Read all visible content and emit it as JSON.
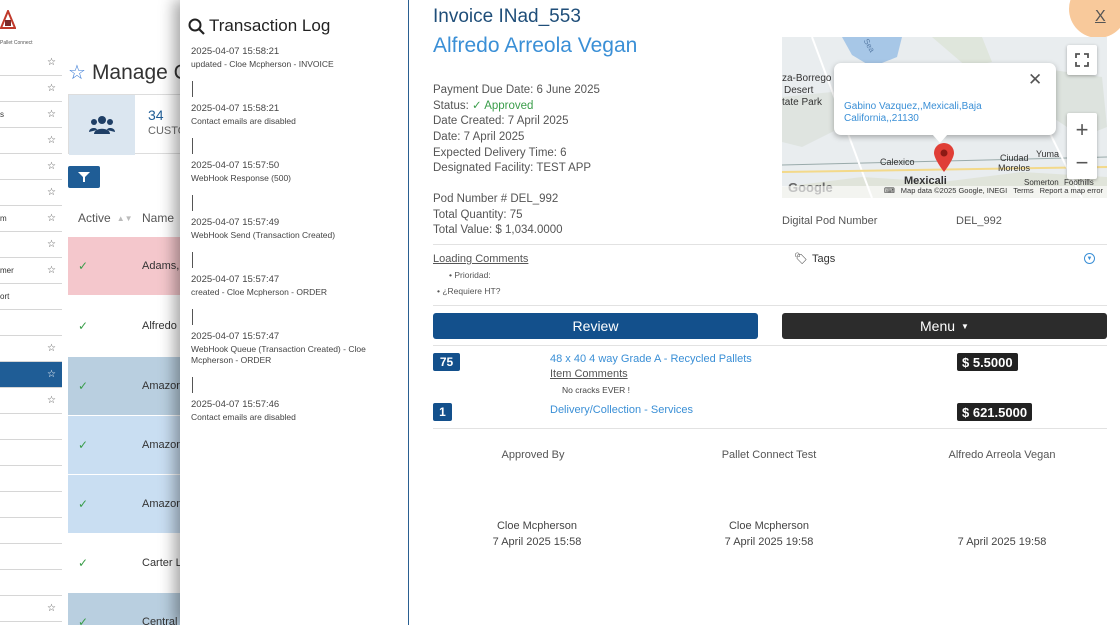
{
  "app": {
    "logo_text": "Pallet Connect",
    "page_title": "Manage C",
    "stat": {
      "count": "34",
      "label": "CUSTO"
    },
    "table": {
      "columns": [
        "Active",
        "Name"
      ],
      "rows": [
        {
          "name": "Adams,",
          "color": "#f4c7cc"
        },
        {
          "name": "Alfredo",
          "color": "#ffffff"
        },
        {
          "name": "Amazon",
          "color": "#b9cfe0"
        },
        {
          "name": "Amazon",
          "color": "#c9def2"
        },
        {
          "name": "Amazon",
          "color": "#c9def2"
        },
        {
          "name": "Carter L",
          "color": "#ffffff"
        },
        {
          "name": "Central",
          "color": "#b9cfe0"
        }
      ]
    },
    "sidebar": [
      {
        "label": ""
      },
      {
        "label": ""
      },
      {
        "label": "s"
      },
      {
        "label": ""
      },
      {
        "label": ""
      },
      {
        "label": ""
      },
      {
        "label": "m"
      },
      {
        "label": ""
      },
      {
        "label": "mer"
      },
      {
        "label": "ort"
      },
      {
        "label": ""
      },
      {
        "label": ""
      },
      {
        "label": ""
      },
      {
        "label": ""
      },
      {
        "label": ""
      },
      {
        "label": ""
      },
      {
        "label": ""
      },
      {
        "label": ""
      },
      {
        "label": ""
      },
      {
        "label": ""
      },
      {
        "label": ""
      },
      {
        "label": ""
      }
    ]
  },
  "txlog": {
    "title": "Transaction Log",
    "entries": [
      {
        "time": "2025-04-07 15:58:21",
        "msg": "updated - Cloe Mcpherson - INVOICE"
      },
      {
        "time": "2025-04-07 15:58:21",
        "msg": "Contact emails are disabled"
      },
      {
        "time": "2025-04-07 15:57:50",
        "msg": "WebHook Response (500)"
      },
      {
        "time": "2025-04-07 15:57:49",
        "msg": "WebHook Send (Transaction Created)"
      },
      {
        "time": "2025-04-07 15:57:47",
        "msg": "created - Cloe Mcpherson - ORDER"
      },
      {
        "time": "2025-04-07 15:57:47",
        "msg": "WebHook Queue (Transaction Created) - Cloe Mcpherson - ORDER"
      },
      {
        "time": "2025-04-07 15:57:46",
        "msg": "Contact emails are disabled"
      }
    ]
  },
  "invoice": {
    "number": "Invoice INad_553",
    "customer": "Alfredo Arreola Vegan",
    "close_label": "X",
    "payment_due": "Payment Due Date: 6 June 2025",
    "status_prefix": "Status:",
    "status_check": "✓",
    "status_value": "Approved",
    "date_created": "Date Created: 7 April 2025",
    "date": "Date: 7 April 2025",
    "expected_delivery": "Expected Delivery Time: 6",
    "facility": "Designated Facility: TEST APP",
    "pod_number": "Pod Number # DEL_992",
    "total_quantity": "Total Quantity: 75",
    "total_value": "Total Value: $ 1,034.0000",
    "digital_pod_label": "Digital Pod Number",
    "digital_pod_value": "DEL_992",
    "loading_comments": "Loading Comments",
    "loading_sub1": "• Prioridad:",
    "loading_sub2": "• ¿Requiere HT?",
    "tags_label": "Tags",
    "review_label": "Review",
    "menu_label": "Menu",
    "items": [
      {
        "qty": "75",
        "name": "48 x 40 4 way Grade A - Recycled Pallets",
        "price": "$ 5.5000"
      },
      {
        "qty": "1",
        "name": "Delivery/Collection - Services",
        "price": "$ 621.5000"
      }
    ],
    "item_comments": "Item Comments",
    "item_note": "No cracks EVER !",
    "signatures": {
      "labels": [
        "Approved By",
        "Pallet Connect Test",
        "Alfredo Arreola Vegan"
      ],
      "names": [
        "Cloe Mcpherson",
        "Cloe Mcpherson",
        ""
      ],
      "dates": [
        "7 April 2025 15:58",
        "7 April 2025 19:58",
        "7 April 2025 19:58"
      ]
    }
  },
  "map": {
    "popup_text": "Gabino Vazquez,,Mexicali,Baja California,,21130",
    "labels": {
      "borrego": "za-Borrego",
      "desert": "Desert",
      "state_park": "tate Park",
      "calexico": "Calexico",
      "mexicali": "Mexicali",
      "ciudad": "Ciudad",
      "morelos": "Morelos",
      "yuma": "Yuma",
      "somerton": "Somerton",
      "foothills": "Foothills",
      "sea": "Sea"
    },
    "footer": {
      "data": "Map data ©2025 Google, INEGI",
      "terms": "Terms",
      "report": "Report a map error"
    },
    "google": "Google"
  },
  "colors": {
    "primary": "#13508c",
    "accent": "#3a8fd6",
    "approved": "#3a9d4a",
    "dark": "#2c2c2c"
  }
}
